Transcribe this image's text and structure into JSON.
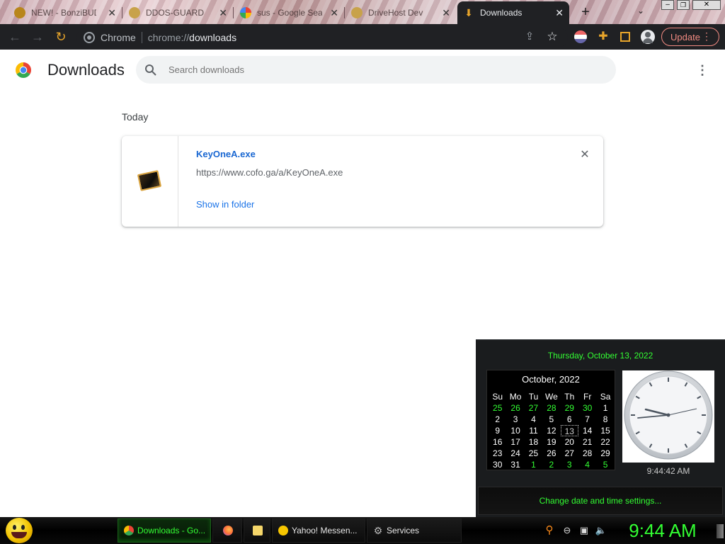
{
  "tabs": [
    {
      "title": "NEW! - BonziBUDDY",
      "favicon": "bonzi-icon"
    },
    {
      "title": "DDOS-GUARD",
      "favicon": "ddos-guard-icon"
    },
    {
      "title": "sus - Google Search",
      "favicon": "google-icon"
    },
    {
      "title": "DriveHost Dev",
      "favicon": "drivehost-icon"
    },
    {
      "title": "Downloads",
      "favicon": "download-icon",
      "active": true
    }
  ],
  "toolbar": {
    "site_label": "Chrome",
    "url_prefix": "chrome://",
    "url_path": "downloads",
    "update_label": "Update"
  },
  "page": {
    "title": "Downloads",
    "search_placeholder": "Search downloads",
    "section_label": "Today",
    "download": {
      "filename": "KeyOneA.exe",
      "url": "https://www.cofo.ga/a/KeyOneA.exe",
      "action_label": "Show in folder"
    }
  },
  "clock_flyout": {
    "full_date": "Thursday, October 13, 2022",
    "month_label": "October, 2022",
    "weekdays": [
      "Su",
      "Mo",
      "Tu",
      "We",
      "Th",
      "Fr",
      "Sa"
    ],
    "weeks": [
      [
        {
          "d": "25",
          "o": true
        },
        {
          "d": "26",
          "o": true
        },
        {
          "d": "27",
          "o": true
        },
        {
          "d": "28",
          "o": true
        },
        {
          "d": "29",
          "o": true
        },
        {
          "d": "30",
          "o": true
        },
        {
          "d": "1"
        }
      ],
      [
        {
          "d": "2"
        },
        {
          "d": "3"
        },
        {
          "d": "4"
        },
        {
          "d": "5"
        },
        {
          "d": "6"
        },
        {
          "d": "7"
        },
        {
          "d": "8"
        }
      ],
      [
        {
          "d": "9"
        },
        {
          "d": "10"
        },
        {
          "d": "11"
        },
        {
          "d": "12"
        },
        {
          "d": "13",
          "t": true
        },
        {
          "d": "14"
        },
        {
          "d": "15"
        }
      ],
      [
        {
          "d": "16"
        },
        {
          "d": "17"
        },
        {
          "d": "18"
        },
        {
          "d": "19"
        },
        {
          "d": "20"
        },
        {
          "d": "21"
        },
        {
          "d": "22"
        }
      ],
      [
        {
          "d": "23"
        },
        {
          "d": "24"
        },
        {
          "d": "25"
        },
        {
          "d": "26"
        },
        {
          "d": "27"
        },
        {
          "d": "28"
        },
        {
          "d": "29"
        }
      ],
      [
        {
          "d": "30"
        },
        {
          "d": "31"
        },
        {
          "d": "1",
          "o": true
        },
        {
          "d": "2",
          "o": true
        },
        {
          "d": "3",
          "o": true
        },
        {
          "d": "4",
          "o": true
        },
        {
          "d": "5",
          "o": true
        }
      ]
    ],
    "time_label": "9:44:42 AM",
    "change_label": "Change date and time settings..."
  },
  "taskbar": {
    "items": [
      {
        "label": "Downloads - Go...",
        "icon": "chrome-icon",
        "active": true
      },
      {
        "label": "",
        "icon": "firefox-icon"
      },
      {
        "label": "",
        "icon": "folder-icon"
      },
      {
        "label": "Yahoo! Messen...",
        "icon": "yahoo-messenger-icon"
      },
      {
        "label": "Services",
        "icon": "gear-icon"
      }
    ],
    "clock": "9:44 AM"
  },
  "colors": {
    "accent_blue": "#1a73e8",
    "link_blue": "#1967d2",
    "toolbar_dark": "#202124",
    "update_red": "#f28b82",
    "hacker_green": "#33ff33"
  }
}
